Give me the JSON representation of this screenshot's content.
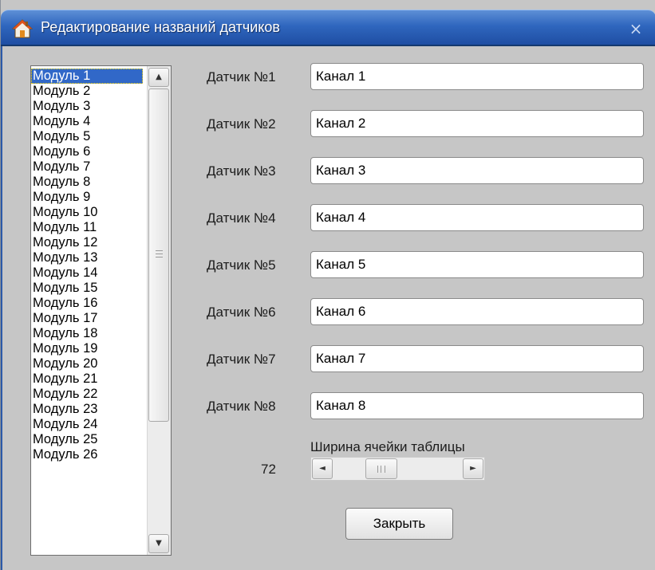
{
  "window": {
    "title": "Редактирование названий датчиков",
    "close_glyph": "×",
    "title_icon": "home-icon"
  },
  "modules": {
    "selected_index": 0,
    "items": [
      "Модуль 1",
      "Модуль 2",
      "Модуль 3",
      "Модуль 4",
      "Модуль 5",
      "Модуль 6",
      "Модуль 7",
      "Модуль 8",
      "Модуль 9",
      "Модуль 10",
      "Модуль 11",
      "Модуль 12",
      "Модуль 13",
      "Модуль 14",
      "Модуль 15",
      "Модуль 16",
      "Модуль 17",
      "Модуль 18",
      "Модуль 19",
      "Модуль 20",
      "Модуль 21",
      "Модуль 22",
      "Модуль 23",
      "Модуль 24",
      "Модуль 25",
      "Модуль 26"
    ],
    "scroll_up_glyph": "▲",
    "scroll_down_glyph": "▼"
  },
  "sensors": [
    {
      "label": "Датчик №1",
      "value": "Канал 1"
    },
    {
      "label": "Датчик №2",
      "value": "Канал 2"
    },
    {
      "label": "Датчик №3",
      "value": "Канал 3"
    },
    {
      "label": "Датчик №4",
      "value": "Канал 4"
    },
    {
      "label": "Датчик №5",
      "value": "Канал 5"
    },
    {
      "label": "Датчик №6",
      "value": "Канал 6"
    },
    {
      "label": "Датчик №7",
      "value": "Канал 7"
    },
    {
      "label": "Датчик №8",
      "value": "Канал 8"
    }
  ],
  "cell_width": {
    "label": "Ширина ячейки таблицы",
    "value": "72",
    "slider_fraction": 0.33,
    "left_glyph": "◄",
    "right_glyph": "►"
  },
  "close_button": {
    "label": "Закрыть"
  },
  "colors": {
    "titlebar": "#2f66be",
    "selection": "#3168c8",
    "background": "#c6c6c6"
  }
}
